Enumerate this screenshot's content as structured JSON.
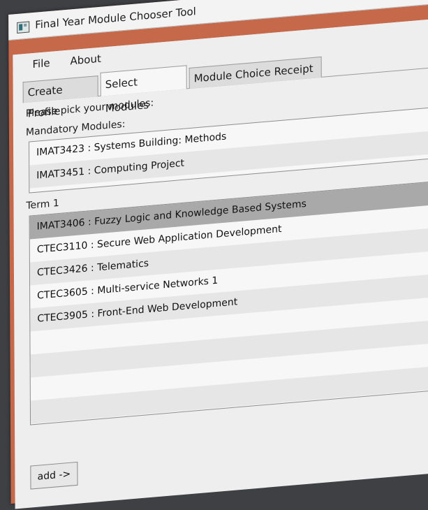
{
  "window": {
    "title": "Final Year Module Chooser Tool",
    "accent": "#c6684a"
  },
  "menu": {
    "items": [
      "File",
      "About"
    ]
  },
  "tabs": [
    "Create Profile",
    "Select Modules",
    "Module Choice Receipt"
  ],
  "active_tab": "Select Modules",
  "prompt": "Please pick your modules:",
  "mandatory": {
    "label": "Mandatory Modules:",
    "items": [
      "IMAT3423 : Systems Building: Methods",
      "IMAT3451 : Computing Project"
    ]
  },
  "term1": {
    "label": "Term 1",
    "items": [
      "IMAT3406 : Fuzzy Logic and Knowledge Based Systems",
      "CTEC3110 : Secure Web Application Development",
      "CTEC3426 : Telematics",
      "CTEC3605 : Multi-service Networks 1",
      "CTEC3905 : Front-End Web Development"
    ],
    "selected": "IMAT3406 : Fuzzy Logic and Knowledge Based Systems"
  },
  "add_button": "add ->"
}
